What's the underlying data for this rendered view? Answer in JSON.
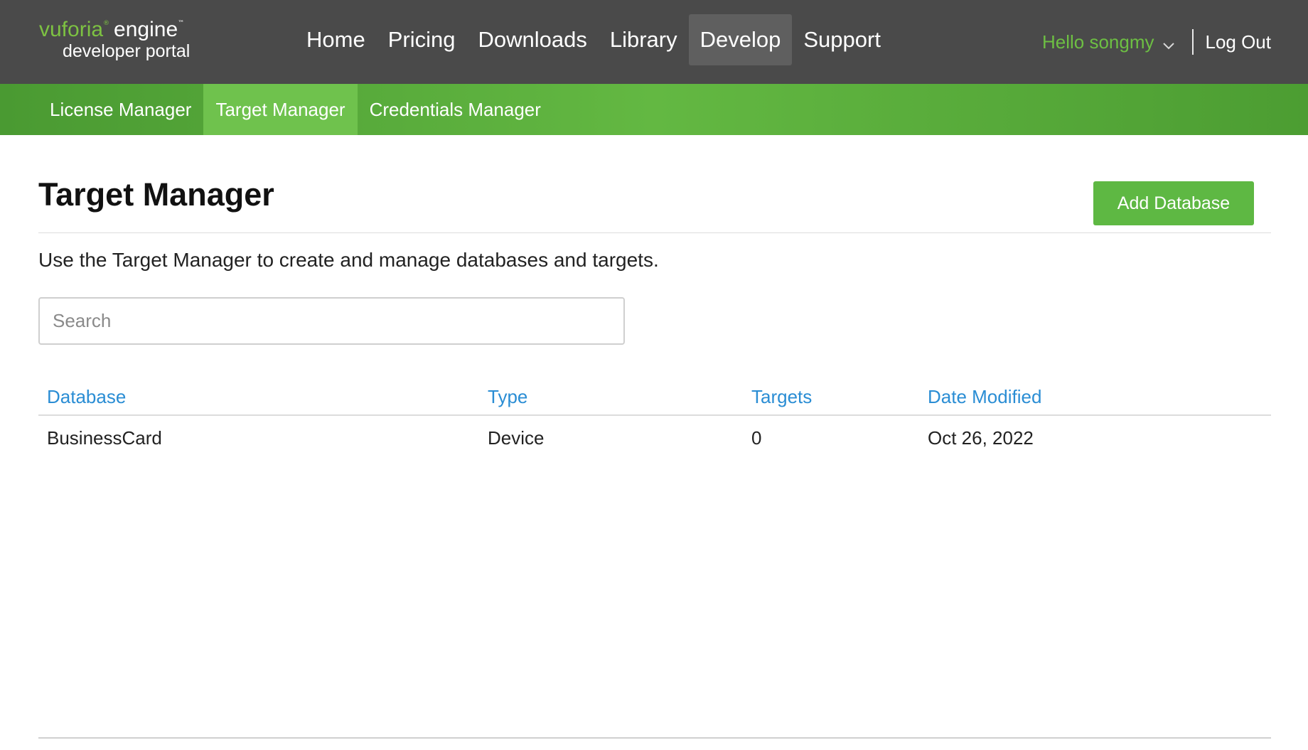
{
  "logo": {
    "brand": "vuforia",
    "brand_mark": "®",
    "product": "engine",
    "product_mark": "™",
    "subtitle": "developer portal"
  },
  "main_nav": {
    "items": [
      {
        "label": "Home"
      },
      {
        "label": "Pricing"
      },
      {
        "label": "Downloads"
      },
      {
        "label": "Library"
      },
      {
        "label": "Develop",
        "active": true
      },
      {
        "label": "Support"
      }
    ]
  },
  "user_menu": {
    "greeting": "Hello songmy",
    "logout_label": "Log Out",
    "chevron_icon": "chevron-down-icon"
  },
  "sub_nav": {
    "tabs": [
      {
        "label": "License Manager"
      },
      {
        "label": "Target Manager",
        "active": true
      },
      {
        "label": "Credentials Manager"
      }
    ]
  },
  "page": {
    "title": "Target Manager",
    "add_button_label": "Add Database",
    "intro": "Use the Target Manager to create and manage databases and targets.",
    "search_placeholder": "Search",
    "search_value": ""
  },
  "table": {
    "columns": [
      "Database",
      "Type",
      "Targets",
      "Date Modified"
    ],
    "rows": [
      {
        "database": "BusinessCard",
        "type": "Device",
        "targets": "0",
        "date_modified": "Oct 26, 2022"
      }
    ]
  },
  "colors": {
    "topbar_bg": "#4a4a4a",
    "brand_green": "#5eb843",
    "link_blue": "#2a8dd4"
  }
}
